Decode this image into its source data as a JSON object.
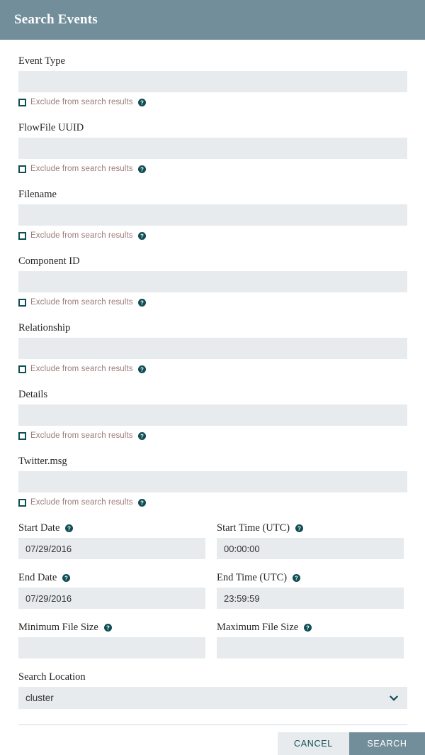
{
  "header": {
    "title": "Search Events"
  },
  "colors": {
    "header_bg": "#728e9b",
    "input_bg": "#e7ebee",
    "accent_teal": "#0f4e54",
    "exclude_label": "#9d7b7b",
    "label_text": "#262626",
    "divider": "#cdd6dd",
    "search_button_bg": "#728e9b",
    "cancel_button_bg": "#e7ebee"
  },
  "icons": {
    "help": "help-circle-icon",
    "chevron": "chevron-down-icon",
    "checkbox": "checkbox-unchecked-icon"
  },
  "exclude_label": "Exclude from search results",
  "fields": [
    {
      "label": "Event Type",
      "value": "",
      "placeholder": "",
      "exclude_checked": false
    },
    {
      "label": "FlowFile UUID",
      "value": "",
      "placeholder": "",
      "exclude_checked": false
    },
    {
      "label": "Filename",
      "value": "",
      "placeholder": "",
      "exclude_checked": false
    },
    {
      "label": "Component ID",
      "value": "",
      "placeholder": "",
      "exclude_checked": false
    },
    {
      "label": "Relationship",
      "value": "",
      "placeholder": "",
      "exclude_checked": false
    },
    {
      "label": "Details",
      "value": "",
      "placeholder": "",
      "exclude_checked": false
    },
    {
      "label": "Twitter.msg",
      "value": "",
      "placeholder": "",
      "exclude_checked": false
    }
  ],
  "date_rows": [
    {
      "left": {
        "label": "Start Date",
        "value": "07/29/2016",
        "has_help": true
      },
      "right": {
        "label": "Start Time (UTC)",
        "value": "00:00:00",
        "has_help": true
      }
    },
    {
      "left": {
        "label": "End Date",
        "value": "07/29/2016",
        "has_help": true
      },
      "right": {
        "label": "End Time (UTC)",
        "value": "23:59:59",
        "has_help": true
      }
    },
    {
      "left": {
        "label": "Minimum File Size",
        "value": "",
        "has_help": true
      },
      "right": {
        "label": "Maximum File Size",
        "value": "",
        "has_help": true
      }
    }
  ],
  "search_location": {
    "label": "Search Location",
    "selected": "cluster",
    "options": [
      "cluster"
    ]
  },
  "buttons": {
    "cancel": "CANCEL",
    "search": "SEARCH"
  }
}
